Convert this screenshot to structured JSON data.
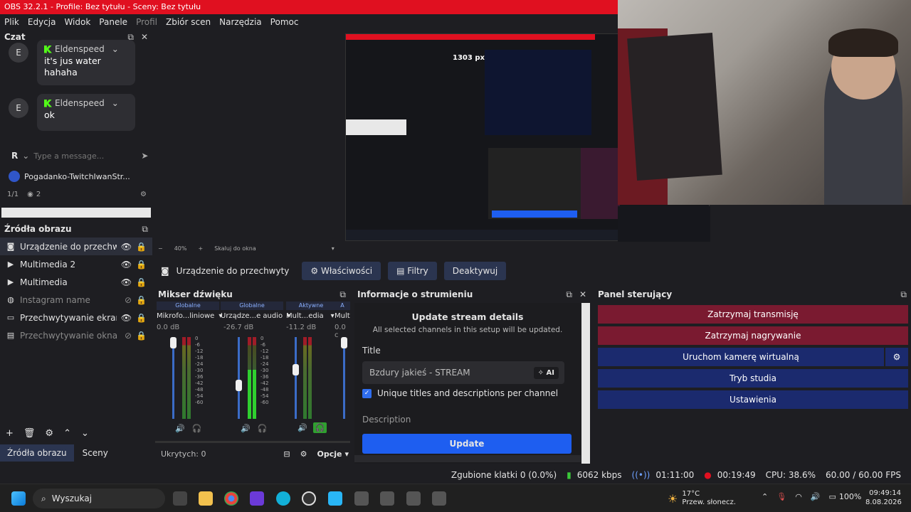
{
  "window": {
    "title": "OBS 32.2.1 - Profile: Bez tytułu - Sceny: Bez tytułu"
  },
  "menu": [
    "Plik",
    "Edycja",
    "Widok",
    "Panele",
    "Profil",
    "Zbiór scen",
    "Narzędzia",
    "Pomoc"
  ],
  "chat": {
    "title": "Czat",
    "messages": [
      {
        "avatar": "E",
        "user": "Eldenspeed",
        "text": "it's jus water hahaha"
      },
      {
        "avatar": "E",
        "user": "Eldenspeed",
        "text": "ok"
      }
    ],
    "input_avatar": "R",
    "input_placeholder": "Type a message...",
    "channel": "Pogadanko-TwitchIwanStr...",
    "page": "1/1",
    "viewers": "2"
  },
  "sources": {
    "title": "Źródła obrazu",
    "items": [
      {
        "name": "Urządzenie do przechwyty",
        "icon": "camera-icon",
        "visible": true,
        "locked": true,
        "selected": true
      },
      {
        "name": "Multimedia 2",
        "icon": "play-icon",
        "visible": true,
        "locked": true
      },
      {
        "name": "Multimedia",
        "icon": "play-icon",
        "visible": true,
        "locked": true
      },
      {
        "name": "Instagram name",
        "icon": "globe-icon",
        "visible": false,
        "locked": true
      },
      {
        "name": "Przechwytywanie ekranu",
        "icon": "monitor-icon",
        "visible": true,
        "locked": true
      },
      {
        "name": "Przechwytywanie okna",
        "icon": "window-icon",
        "visible": false,
        "locked": true
      }
    ],
    "tabs": [
      "Źródła obrazu",
      "Sceny"
    ]
  },
  "preview": {
    "zoom": "40%",
    "scale_label": "Skaluj do okna",
    "inner_px_label": "1303 px"
  },
  "source_toolbar": {
    "name": "Urządzenie do przechwyty",
    "properties": "Właściwości",
    "filters": "Filtry",
    "deactivate": "Deaktywuj"
  },
  "mixer": {
    "title": "Mikser dźwięku",
    "channels": [
      {
        "tag": "Globalne",
        "name": "Mikrofo...liniowe",
        "db": "0.0 dB"
      },
      {
        "tag": "Globalne",
        "name": "Urządze...e audio",
        "db": "-26.7 dB"
      },
      {
        "tag": "Aktywne",
        "name": "Mult...edia",
        "db": "-11.2 dB"
      },
      {
        "tag": "A",
        "name": "Mult",
        "db": "0.0 c"
      }
    ],
    "scale": [
      "0",
      "-6",
      "-12",
      "-18",
      "-24",
      "-30",
      "-36",
      "-42",
      "-48",
      "-54",
      "-60"
    ],
    "hidden": "Ukrytych: 0",
    "options": "Opcje"
  },
  "stream_info": {
    "title": "Informacje o strumieniu",
    "heading": "Update stream details",
    "subheading": "All selected channels in this setup will be updated.",
    "title_label": "Title",
    "title_value": "Bzdury jakieś - STREAM",
    "ai_label": "AI",
    "checkbox_label": "Unique titles and descriptions per channel",
    "description_label": "Description",
    "update_button": "Update"
  },
  "control_panel": {
    "title": "Panel sterujący",
    "buttons": [
      "Zatrzymaj transmisję",
      "Zatrzymaj nagrywanie",
      "Uruchom kamerę wirtualną",
      "Tryb studia",
      "Ustawienia"
    ]
  },
  "status": {
    "dropped": "Zgubione klatki 0 (0.0%)",
    "kbps": "6062 kbps",
    "stream_time": "01:11:00",
    "rec_time": "00:19:49",
    "cpu": "CPU: 38.6%",
    "fps": "60.00 / 60.00 FPS"
  },
  "taskbar": {
    "search": "Wyszukaj",
    "weather_temp": "17°C",
    "weather_desc": "Przew. słonecz.",
    "battery": "100%",
    "time": "09:49:14",
    "date": "8.08.2026"
  },
  "colors": {
    "titlebar": "#e01020",
    "stop_buttons": "#7a1a30",
    "blue_buttons": "#1b2a6e",
    "update_button": "#1e5ef0",
    "kick_green": "#53fc18"
  }
}
